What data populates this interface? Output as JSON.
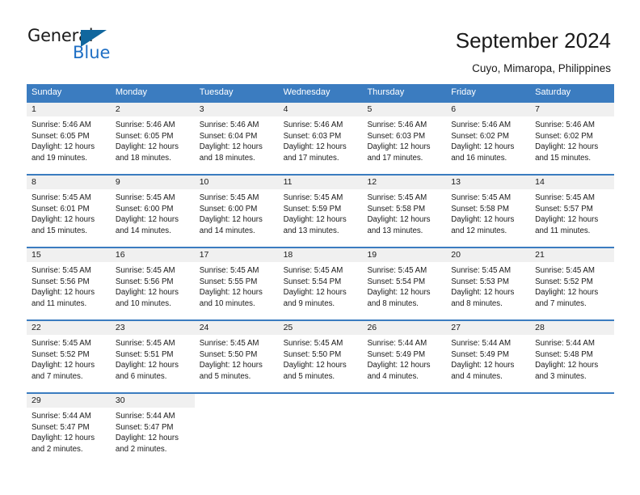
{
  "brand": {
    "name_part1": "General",
    "name_part2": "Blue",
    "triangle_color": "#11679e",
    "blue_color": "#1f6fc4"
  },
  "header": {
    "title": "September 2024",
    "subtitle": "Cuyo, Mimaropa, Philippines"
  },
  "theme": {
    "header_blue": "#3b7cc0",
    "daynum_band": "#f0f0f0",
    "text": "#1a1a1a"
  },
  "weekdays": [
    "Sunday",
    "Monday",
    "Tuesday",
    "Wednesday",
    "Thursday",
    "Friday",
    "Saturday"
  ],
  "weeks": [
    [
      {
        "day": "1",
        "sunrise": "Sunrise: 5:46 AM",
        "sunset": "Sunset: 6:05 PM",
        "daylight1": "Daylight: 12 hours",
        "daylight2": "and 19 minutes."
      },
      {
        "day": "2",
        "sunrise": "Sunrise: 5:46 AM",
        "sunset": "Sunset: 6:05 PM",
        "daylight1": "Daylight: 12 hours",
        "daylight2": "and 18 minutes."
      },
      {
        "day": "3",
        "sunrise": "Sunrise: 5:46 AM",
        "sunset": "Sunset: 6:04 PM",
        "daylight1": "Daylight: 12 hours",
        "daylight2": "and 18 minutes."
      },
      {
        "day": "4",
        "sunrise": "Sunrise: 5:46 AM",
        "sunset": "Sunset: 6:03 PM",
        "daylight1": "Daylight: 12 hours",
        "daylight2": "and 17 minutes."
      },
      {
        "day": "5",
        "sunrise": "Sunrise: 5:46 AM",
        "sunset": "Sunset: 6:03 PM",
        "daylight1": "Daylight: 12 hours",
        "daylight2": "and 17 minutes."
      },
      {
        "day": "6",
        "sunrise": "Sunrise: 5:46 AM",
        "sunset": "Sunset: 6:02 PM",
        "daylight1": "Daylight: 12 hours",
        "daylight2": "and 16 minutes."
      },
      {
        "day": "7",
        "sunrise": "Sunrise: 5:46 AM",
        "sunset": "Sunset: 6:02 PM",
        "daylight1": "Daylight: 12 hours",
        "daylight2": "and 15 minutes."
      }
    ],
    [
      {
        "day": "8",
        "sunrise": "Sunrise: 5:45 AM",
        "sunset": "Sunset: 6:01 PM",
        "daylight1": "Daylight: 12 hours",
        "daylight2": "and 15 minutes."
      },
      {
        "day": "9",
        "sunrise": "Sunrise: 5:45 AM",
        "sunset": "Sunset: 6:00 PM",
        "daylight1": "Daylight: 12 hours",
        "daylight2": "and 14 minutes."
      },
      {
        "day": "10",
        "sunrise": "Sunrise: 5:45 AM",
        "sunset": "Sunset: 6:00 PM",
        "daylight1": "Daylight: 12 hours",
        "daylight2": "and 14 minutes."
      },
      {
        "day": "11",
        "sunrise": "Sunrise: 5:45 AM",
        "sunset": "Sunset: 5:59 PM",
        "daylight1": "Daylight: 12 hours",
        "daylight2": "and 13 minutes."
      },
      {
        "day": "12",
        "sunrise": "Sunrise: 5:45 AM",
        "sunset": "Sunset: 5:58 PM",
        "daylight1": "Daylight: 12 hours",
        "daylight2": "and 13 minutes."
      },
      {
        "day": "13",
        "sunrise": "Sunrise: 5:45 AM",
        "sunset": "Sunset: 5:58 PM",
        "daylight1": "Daylight: 12 hours",
        "daylight2": "and 12 minutes."
      },
      {
        "day": "14",
        "sunrise": "Sunrise: 5:45 AM",
        "sunset": "Sunset: 5:57 PM",
        "daylight1": "Daylight: 12 hours",
        "daylight2": "and 11 minutes."
      }
    ],
    [
      {
        "day": "15",
        "sunrise": "Sunrise: 5:45 AM",
        "sunset": "Sunset: 5:56 PM",
        "daylight1": "Daylight: 12 hours",
        "daylight2": "and 11 minutes."
      },
      {
        "day": "16",
        "sunrise": "Sunrise: 5:45 AM",
        "sunset": "Sunset: 5:56 PM",
        "daylight1": "Daylight: 12 hours",
        "daylight2": "and 10 minutes."
      },
      {
        "day": "17",
        "sunrise": "Sunrise: 5:45 AM",
        "sunset": "Sunset: 5:55 PM",
        "daylight1": "Daylight: 12 hours",
        "daylight2": "and 10 minutes."
      },
      {
        "day": "18",
        "sunrise": "Sunrise: 5:45 AM",
        "sunset": "Sunset: 5:54 PM",
        "daylight1": "Daylight: 12 hours",
        "daylight2": "and 9 minutes."
      },
      {
        "day": "19",
        "sunrise": "Sunrise: 5:45 AM",
        "sunset": "Sunset: 5:54 PM",
        "daylight1": "Daylight: 12 hours",
        "daylight2": "and 8 minutes."
      },
      {
        "day": "20",
        "sunrise": "Sunrise: 5:45 AM",
        "sunset": "Sunset: 5:53 PM",
        "daylight1": "Daylight: 12 hours",
        "daylight2": "and 8 minutes."
      },
      {
        "day": "21",
        "sunrise": "Sunrise: 5:45 AM",
        "sunset": "Sunset: 5:52 PM",
        "daylight1": "Daylight: 12 hours",
        "daylight2": "and 7 minutes."
      }
    ],
    [
      {
        "day": "22",
        "sunrise": "Sunrise: 5:45 AM",
        "sunset": "Sunset: 5:52 PM",
        "daylight1": "Daylight: 12 hours",
        "daylight2": "and 7 minutes."
      },
      {
        "day": "23",
        "sunrise": "Sunrise: 5:45 AM",
        "sunset": "Sunset: 5:51 PM",
        "daylight1": "Daylight: 12 hours",
        "daylight2": "and 6 minutes."
      },
      {
        "day": "24",
        "sunrise": "Sunrise: 5:45 AM",
        "sunset": "Sunset: 5:50 PM",
        "daylight1": "Daylight: 12 hours",
        "daylight2": "and 5 minutes."
      },
      {
        "day": "25",
        "sunrise": "Sunrise: 5:45 AM",
        "sunset": "Sunset: 5:50 PM",
        "daylight1": "Daylight: 12 hours",
        "daylight2": "and 5 minutes."
      },
      {
        "day": "26",
        "sunrise": "Sunrise: 5:44 AM",
        "sunset": "Sunset: 5:49 PM",
        "daylight1": "Daylight: 12 hours",
        "daylight2": "and 4 minutes."
      },
      {
        "day": "27",
        "sunrise": "Sunrise: 5:44 AM",
        "sunset": "Sunset: 5:49 PM",
        "daylight1": "Daylight: 12 hours",
        "daylight2": "and 4 minutes."
      },
      {
        "day": "28",
        "sunrise": "Sunrise: 5:44 AM",
        "sunset": "Sunset: 5:48 PM",
        "daylight1": "Daylight: 12 hours",
        "daylight2": "and 3 minutes."
      }
    ],
    [
      {
        "day": "29",
        "sunrise": "Sunrise: 5:44 AM",
        "sunset": "Sunset: 5:47 PM",
        "daylight1": "Daylight: 12 hours",
        "daylight2": "and 2 minutes."
      },
      {
        "day": "30",
        "sunrise": "Sunrise: 5:44 AM",
        "sunset": "Sunset: 5:47 PM",
        "daylight1": "Daylight: 12 hours",
        "daylight2": "and 2 minutes."
      },
      {
        "day": "",
        "sunrise": "",
        "sunset": "",
        "daylight1": "",
        "daylight2": ""
      },
      {
        "day": "",
        "sunrise": "",
        "sunset": "",
        "daylight1": "",
        "daylight2": ""
      },
      {
        "day": "",
        "sunrise": "",
        "sunset": "",
        "daylight1": "",
        "daylight2": ""
      },
      {
        "day": "",
        "sunrise": "",
        "sunset": "",
        "daylight1": "",
        "daylight2": ""
      },
      {
        "day": "",
        "sunrise": "",
        "sunset": "",
        "daylight1": "",
        "daylight2": ""
      }
    ]
  ]
}
